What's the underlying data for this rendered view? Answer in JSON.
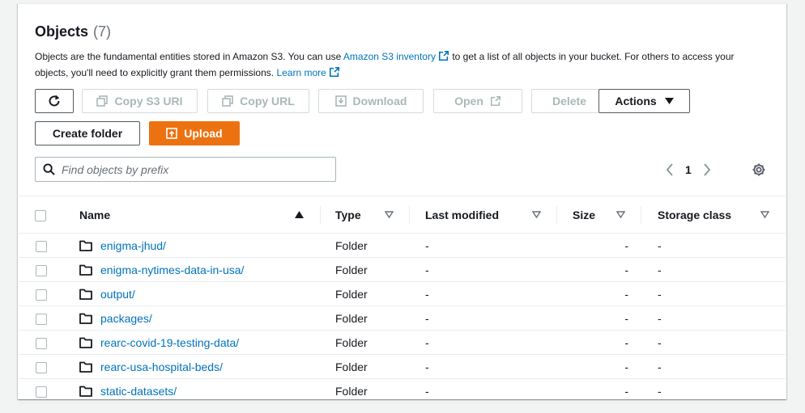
{
  "header": {
    "title": "Objects",
    "count": "(7)",
    "desc_part1": "Objects are the fundamental entities stored in Amazon S3. You can use ",
    "inventory_link": "Amazon S3 inventory",
    "desc_part2": " to get a list of all objects in your bucket. For others to access your objects, you'll need to explicitly grant them permissions. ",
    "learn_more": "Learn more"
  },
  "toolbar": {
    "copy_s3_uri": "Copy S3 URI",
    "copy_url": "Copy URL",
    "download": "Download",
    "open": "Open",
    "delete": "Delete",
    "actions": "Actions",
    "create_folder": "Create folder",
    "upload": "Upload"
  },
  "search": {
    "placeholder": "Find objects by prefix"
  },
  "pagination": {
    "page": "1"
  },
  "table": {
    "columns": {
      "name": "Name",
      "type": "Type",
      "last_modified": "Last modified",
      "size": "Size",
      "storage_class": "Storage class"
    },
    "rows": [
      {
        "name": "enigma-jhud/",
        "type": "Folder",
        "last_modified": "-",
        "size": "-",
        "storage_class": "-"
      },
      {
        "name": "enigma-nytimes-data-in-usa/",
        "type": "Folder",
        "last_modified": "-",
        "size": "-",
        "storage_class": "-"
      },
      {
        "name": "output/",
        "type": "Folder",
        "last_modified": "-",
        "size": "-",
        "storage_class": "-"
      },
      {
        "name": "packages/",
        "type": "Folder",
        "last_modified": "-",
        "size": "-",
        "storage_class": "-"
      },
      {
        "name": "rearc-covid-19-testing-data/",
        "type": "Folder",
        "last_modified": "-",
        "size": "-",
        "storage_class": "-"
      },
      {
        "name": "rearc-usa-hospital-beds/",
        "type": "Folder",
        "last_modified": "-",
        "size": "-",
        "storage_class": "-"
      },
      {
        "name": "static-datasets/",
        "type": "Folder",
        "last_modified": "-",
        "size": "-",
        "storage_class": "-"
      }
    ]
  },
  "colors": {
    "link": "#0073bb",
    "primary": "#ec7211",
    "disabled": "#aab7b8"
  }
}
